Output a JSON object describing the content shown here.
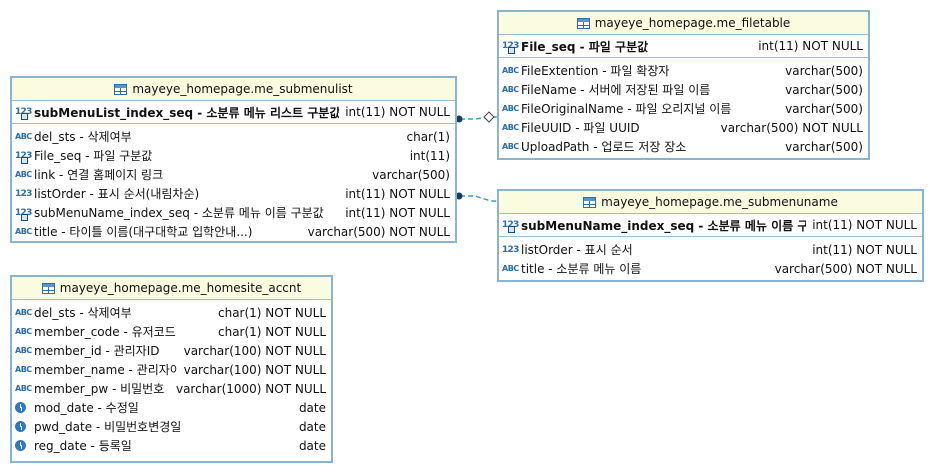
{
  "tables": {
    "submenulist": {
      "title": "mayeye_homepage.me_submenulist",
      "pk": {
        "icon": "key-number-icon",
        "name": "subMenuList_index_seq - 소분류 메뉴 리스트 구분값",
        "type": "int(11) NOT NULL"
      },
      "columns": [
        {
          "icon": "abc-icon",
          "name": "del_sts - 삭제여부",
          "type": "char(1)"
        },
        {
          "icon": "foreign-key-number-icon",
          "name": "File_seq - 파일 구분값",
          "type": "int(11)"
        },
        {
          "icon": "abc-icon",
          "name": "link - 연결 홈페이지 링크",
          "type": "varchar(500)"
        },
        {
          "icon": "number-icon",
          "name": "listOrder - 표시 순서(내림차순)",
          "type": "int(11) NOT NULL"
        },
        {
          "icon": "foreign-key-number-icon",
          "name": "subMenuName_index_seq - 소분류 메뉴 이름 구분값",
          "type": "int(11) NOT NULL"
        },
        {
          "icon": "abc-icon",
          "name": "title - 타이틀 이름(대구대학교 입학안내...)",
          "type": "varchar(500) NOT NULL"
        }
      ]
    },
    "filetable": {
      "title": "mayeye_homepage.me_filetable",
      "pk": {
        "icon": "key-number-icon",
        "name": "File_seq - 파일 구분값",
        "type": "int(11) NOT NULL"
      },
      "columns": [
        {
          "icon": "abc-icon",
          "name": "FileExtention - 파일 확장자",
          "type": "varchar(500)"
        },
        {
          "icon": "abc-icon",
          "name": "FileName - 서버에 저장된 파일 이름",
          "type": "varchar(500)"
        },
        {
          "icon": "abc-icon",
          "name": "FileOriginalName - 파일 오리지널 이름",
          "type": "varchar(500)"
        },
        {
          "icon": "abc-icon",
          "name": "FileUUID - 파일 UUID",
          "type": "varchar(500) NOT NULL"
        },
        {
          "icon": "abc-icon",
          "name": "UploadPath - 업로드 저장 장소",
          "type": "varchar(500)"
        }
      ]
    },
    "submenuname": {
      "title": "mayeye_homepage.me_submenuname",
      "pk": {
        "icon": "key-number-icon",
        "name": "subMenuName_index_seq - 소분류 메뉴 이름 구분값",
        "type": "int(11) NOT NULL"
      },
      "columns": [
        {
          "icon": "number-icon",
          "name": "listOrder - 표시 순서",
          "type": "int(11) NOT NULL"
        },
        {
          "icon": "abc-icon",
          "name": "title - 소분류 메뉴 이름",
          "type": "varchar(500) NOT NULL"
        }
      ]
    },
    "homesite_accnt": {
      "title": "mayeye_homepage.me_homesite_accnt",
      "columns": [
        {
          "icon": "abc-icon",
          "name": "del_sts - 삭제여부",
          "type": "char(1) NOT NULL"
        },
        {
          "icon": "abc-icon",
          "name": "member_code - 유저코드",
          "type": "char(1) NOT NULL"
        },
        {
          "icon": "abc-icon",
          "name": "member_id - 관리자ID",
          "type": "varchar(100) NOT NULL"
        },
        {
          "icon": "abc-icon",
          "name": "member_name - 관리자이름",
          "type": "varchar(100) NOT NULL"
        },
        {
          "icon": "abc-icon",
          "name": "member_pw - 비밀번호",
          "type": "varchar(1000) NOT NULL"
        },
        {
          "icon": "clock-icon",
          "name": "mod_date - 수정일",
          "type": "date"
        },
        {
          "icon": "clock-icon",
          "name": "pwd_date - 비밀번호변경일",
          "type": "date"
        },
        {
          "icon": "clock-icon",
          "name": "reg_date - 등록일",
          "type": "date"
        }
      ]
    }
  },
  "icon_glyphs": {
    "abc": "ABC",
    "number": "123"
  },
  "colors": {
    "border": "#8ab4cf",
    "header_bg": "#fbfbdf",
    "icon": "#2a6db0",
    "link": "#3a9bd0"
  }
}
